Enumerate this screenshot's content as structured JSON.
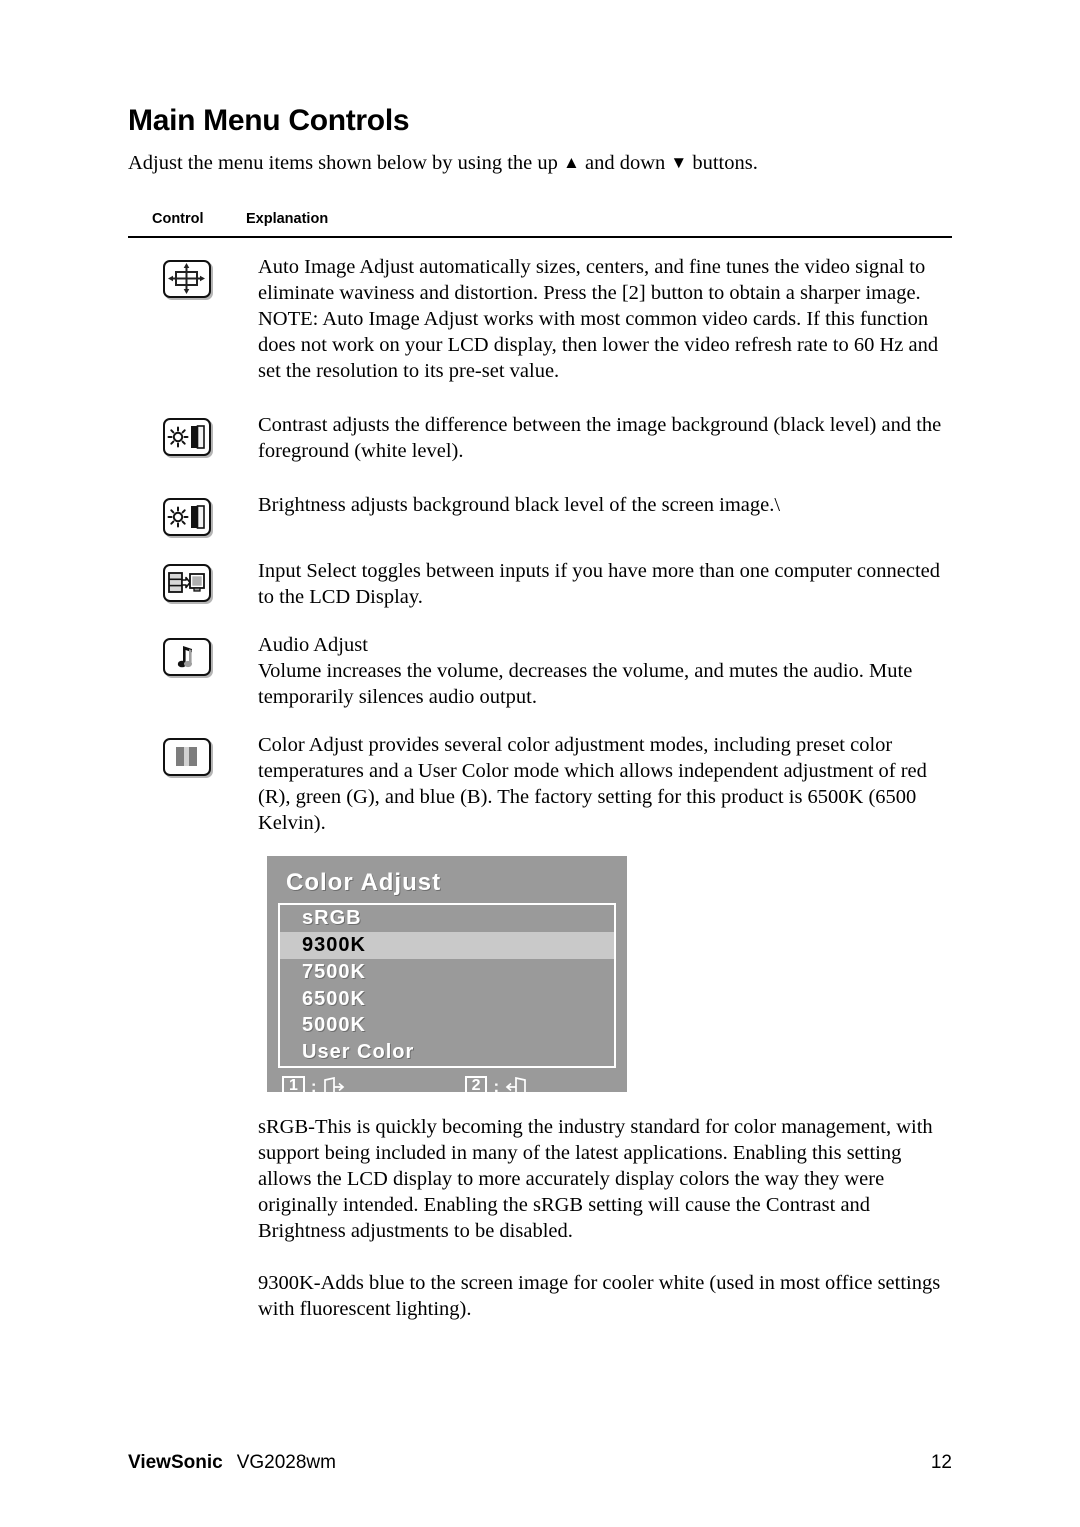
{
  "document": {
    "title": "Main Menu Controls",
    "intro_before": "Adjust the menu items shown below by using the up ",
    "intro_up_glyph": "▲",
    "intro_middle": " and down ",
    "intro_down_glyph": "▼",
    "intro_after": " buttons."
  },
  "table": {
    "headers": {
      "control": "Control",
      "explanation": "Explanation"
    },
    "rows": [
      {
        "icon": "auto-image-adjust-icon",
        "paragraphs": [
          "Auto Image Adjust automatically sizes, centers, and fine tunes the video signal to eliminate waviness and distortion. Press the [2] button to obtain a sharper image.",
          "NOTE: Auto Image Adjust works with most common video cards. If this function does not work on your LCD display, then lower the video refresh rate to 60 Hz and set the resolution to its pre-set value."
        ]
      },
      {
        "icon": "contrast-icon",
        "paragraphs": [
          "Contrast adjusts the difference between the image background  (black level) and the foreground (white level)."
        ]
      },
      {
        "icon": "brightness-icon",
        "paragraphs": [
          "Brightness adjusts background black level of the screen image.\\"
        ]
      },
      {
        "icon": "input-select-icon",
        "paragraphs": [
          "Input Select toggles between inputs if you have more than one computer connected to the LCD Display."
        ]
      },
      {
        "icon": "audio-adjust-icon",
        "paragraphs": [
          "Audio Adjust",
          "Volume increases the volume, decreases the volume, and mutes the audio. Mute temporarily silences audio output."
        ]
      },
      {
        "icon": "color-adjust-icon",
        "paragraphs": [
          "Color Adjust provides several color adjustment modes, including preset color temperatures and a User Color mode which allows independent adjustment of red (R), green (G), and blue (B). The factory setting for this product is 6500K (6500 Kelvin)."
        ]
      }
    ]
  },
  "osd": {
    "title": "Color Adjust",
    "items": [
      {
        "label": "sRGB",
        "selected": false
      },
      {
        "label": "9300K",
        "selected": true
      },
      {
        "label": "7500K",
        "selected": false
      },
      {
        "label": "6500K",
        "selected": false
      },
      {
        "label": "5000K",
        "selected": false
      },
      {
        "label": "User Color",
        "selected": false
      }
    ],
    "footer": {
      "key1_num": "1",
      "key1_colon": ":",
      "key1_icon": "exit-icon",
      "key2_num": "2",
      "key2_colon": ":",
      "key2_icon": "enter-icon"
    },
    "colors": {
      "background": "#9a9a9a",
      "highlight": "#c9c9c9",
      "text": "#ffffff",
      "selected_text": "#000000"
    }
  },
  "notes": {
    "srgb": "sRGB-This is quickly becoming the industry standard for color management, with support being included in many of the latest applications. Enabling this setting allows the LCD display to more accurately display colors the way they were originally intended. Enabling the sRGB setting will cause the Contrast and Brightness adjustments to be disabled.",
    "k9300": "9300K-Adds blue to the screen image for cooler white (used in most office settings with fluorescent lighting)."
  },
  "footer": {
    "brand": "ViewSonic",
    "model": "VG2028wm",
    "page_number": "12"
  }
}
